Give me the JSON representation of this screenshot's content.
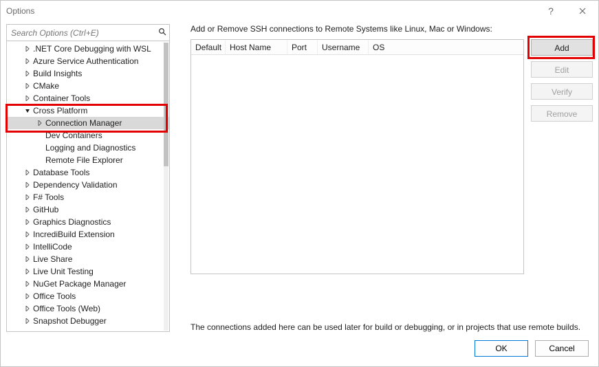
{
  "window": {
    "title": "Options"
  },
  "search": {
    "placeholder": "Search Options (Ctrl+E)"
  },
  "tree": {
    "items": [
      {
        "label": ".NET Core Debugging with WSL",
        "depth": 1,
        "arrow": "right"
      },
      {
        "label": "Azure Service Authentication",
        "depth": 1,
        "arrow": "right"
      },
      {
        "label": "Build Insights",
        "depth": 1,
        "arrow": "right"
      },
      {
        "label": "CMake",
        "depth": 1,
        "arrow": "right"
      },
      {
        "label": "Container Tools",
        "depth": 1,
        "arrow": "right"
      },
      {
        "label": "Cross Platform",
        "depth": 1,
        "arrow": "down"
      },
      {
        "label": "Connection Manager",
        "depth": 2,
        "arrow": "right",
        "selected": true
      },
      {
        "label": "Dev Containers",
        "depth": 2,
        "arrow": "none"
      },
      {
        "label": "Logging and Diagnostics",
        "depth": 2,
        "arrow": "none"
      },
      {
        "label": "Remote File Explorer",
        "depth": 2,
        "arrow": "none"
      },
      {
        "label": "Database Tools",
        "depth": 1,
        "arrow": "right"
      },
      {
        "label": "Dependency Validation",
        "depth": 1,
        "arrow": "right"
      },
      {
        "label": "F# Tools",
        "depth": 1,
        "arrow": "right"
      },
      {
        "label": "GitHub",
        "depth": 1,
        "arrow": "right"
      },
      {
        "label": "Graphics Diagnostics",
        "depth": 1,
        "arrow": "right"
      },
      {
        "label": "IncrediBuild Extension",
        "depth": 1,
        "arrow": "right"
      },
      {
        "label": "IntelliCode",
        "depth": 1,
        "arrow": "right"
      },
      {
        "label": "Live Share",
        "depth": 1,
        "arrow": "right"
      },
      {
        "label": "Live Unit Testing",
        "depth": 1,
        "arrow": "right"
      },
      {
        "label": "NuGet Package Manager",
        "depth": 1,
        "arrow": "right"
      },
      {
        "label": "Office Tools",
        "depth": 1,
        "arrow": "right"
      },
      {
        "label": "Office Tools (Web)",
        "depth": 1,
        "arrow": "right"
      },
      {
        "label": "Snapshot Debugger",
        "depth": 1,
        "arrow": "right"
      }
    ]
  },
  "main": {
    "desc_top": "Add or Remove SSH connections to Remote Systems like Linux, Mac or Windows:",
    "grid_headers": [
      "Default",
      "Host Name",
      "Port",
      "Username",
      "OS"
    ],
    "desc_bottom": "The connections added here can be used later for build or debugging, or in projects that use remote builds."
  },
  "buttons": {
    "add": "Add",
    "edit": "Edit",
    "verify": "Verify",
    "remove": "Remove"
  },
  "footer": {
    "ok": "OK",
    "cancel": "Cancel"
  }
}
